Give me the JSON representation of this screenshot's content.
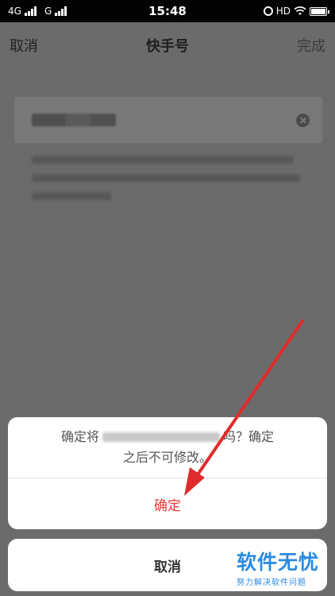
{
  "status_bar": {
    "network_left": "4G",
    "network_right": "G",
    "time": "15:48",
    "hd": "HD"
  },
  "nav": {
    "cancel_label": "取消",
    "title": "快手号",
    "done_label": "完成"
  },
  "dialog": {
    "message_prefix": "确定将",
    "message_suffix": "吗？确定",
    "message_line2": "之后不可修改。",
    "confirm_label": "确定"
  },
  "cancel_sheet": {
    "label": "取消"
  },
  "watermark": {
    "title": "软件无忧",
    "subtitle": "努力解决软件问题"
  },
  "colors": {
    "accent_red": "#e53935",
    "annotation_arrow": "#e02b2b",
    "watermark_blue": "#2a8ae0"
  }
}
